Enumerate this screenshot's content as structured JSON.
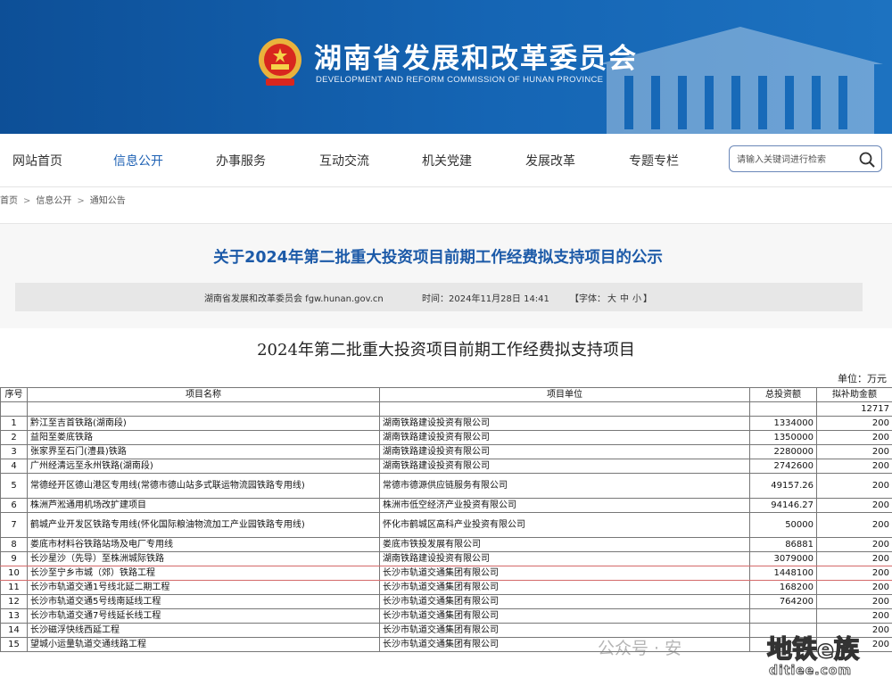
{
  "header": {
    "site_title": "湖南省发展和改革委员会",
    "site_subtitle": "DEVELOPMENT AND REFORM COMMISSION OF HUNAN PROVINCE"
  },
  "nav": {
    "items": [
      {
        "label": "网站首页"
      },
      {
        "label": "信息公开",
        "active": true
      },
      {
        "label": "办事服务"
      },
      {
        "label": "互动交流"
      },
      {
        "label": "机关党建"
      },
      {
        "label": "发展改革"
      },
      {
        "label": "专题专栏"
      }
    ],
    "search_placeholder": "请输入关键词进行检索"
  },
  "breadcrumb": [
    "首页",
    "信息公开",
    "通知公告"
  ],
  "article": {
    "title": "关于2024年第二批重大投资项目前期工作经费拟支持项目的公示",
    "source": "湖南省发展和改革委员会 fgw.hunan.gov.cn",
    "time": "时间：2024年11月28日 14:41",
    "font_label": "【字体：",
    "font_big": "大",
    "font_mid": "中",
    "font_small": "小",
    "font_end": "】"
  },
  "doc": {
    "title": "2024年第二批重大投资项目前期工作经费拟支持项目",
    "unit": "单位：万元",
    "headers": [
      "序号",
      "项目名称",
      "项目单位",
      "总投资额",
      "拟补助金额"
    ],
    "total_subsidy": "12717",
    "rows": [
      {
        "no": "1",
        "name": "黔江至吉首铁路(湖南段)",
        "unit": "湖南铁路建设投资有限公司",
        "invest": "1334000",
        "subsidy": "200"
      },
      {
        "no": "2",
        "name": "益阳至娄底铁路",
        "unit": "湖南铁路建设投资有限公司",
        "invest": "1350000",
        "subsidy": "200"
      },
      {
        "no": "3",
        "name": "张家界至石门(澧县)铁路",
        "unit": "湖南铁路建设投资有限公司",
        "invest": "2280000",
        "subsidy": "200"
      },
      {
        "no": "4",
        "name": "广州经清远至永州铁路(湖南段)",
        "unit": "湖南铁路建设投资有限公司",
        "invest": "2742600",
        "subsidy": "200"
      },
      {
        "no": "5",
        "name": "常德经开区德山港区专用线(常德市德山站多式联运物流园铁路专用线)",
        "unit": "常德市德源供应链服务有限公司",
        "invest": "49157.26",
        "subsidy": "200",
        "tall": true
      },
      {
        "no": "6",
        "name": "株洲芦淞通用机场改扩建项目",
        "unit": "株洲市低空经济产业投资有限公司",
        "invest": "94146.27",
        "subsidy": "200"
      },
      {
        "no": "7",
        "name": "鹤城产业开发区铁路专用线(怀化国际粮油物流加工产业园铁路专用线)",
        "unit": "怀化市鹤城区高科产业投资有限公司",
        "invest": "50000",
        "subsidy": "200",
        "tall": true
      },
      {
        "no": "8",
        "name": "娄底市材料谷铁路站场及电厂专用线",
        "unit": "娄底市铁投发展有限公司",
        "invest": "86881",
        "subsidy": "200"
      },
      {
        "no": "9",
        "name": "长沙星沙（先导）至株洲城际铁路",
        "unit": "湖南铁路建设投资有限公司",
        "invest": "3079000",
        "subsidy": "200",
        "hl": true
      },
      {
        "no": "10",
        "name": "长沙至宁乡市城（郊）铁路工程",
        "unit": "长沙市轨道交通集团有限公司",
        "invest": "1448100",
        "subsidy": "200",
        "hl": true
      },
      {
        "no": "11",
        "name": "长沙市轨道交通1号线北延二期工程",
        "unit": "长沙市轨道交通集团有限公司",
        "invest": "168200",
        "subsidy": "200"
      },
      {
        "no": "12",
        "name": "长沙市轨道交通5号线南延线工程",
        "unit": "长沙市轨道交通集团有限公司",
        "invest": "764200",
        "subsidy": "200"
      },
      {
        "no": "13",
        "name": "长沙市轨道交通7号线延长线工程",
        "unit": "长沙市轨道交通集团有限公司",
        "invest": "",
        "subsidy": "200"
      },
      {
        "no": "14",
        "name": "长沙磁浮快线西延工程",
        "unit": "长沙市轨道交通集团有限公司",
        "invest": "",
        "subsidy": "200"
      },
      {
        "no": "15",
        "name": "望城小运量轨道交通线路工程",
        "unit": "长沙市轨道交通集团有限公司",
        "invest": "",
        "subsidy": "200"
      }
    ]
  },
  "watermark": {
    "wechat": "公众号 · 安",
    "logo_big": "地铁e族",
    "logo_small": "ditiee.com"
  },
  "colors": {
    "banner": "#1565b4",
    "title_blue": "#1c5aa8",
    "highlight": "#d46a6a"
  }
}
